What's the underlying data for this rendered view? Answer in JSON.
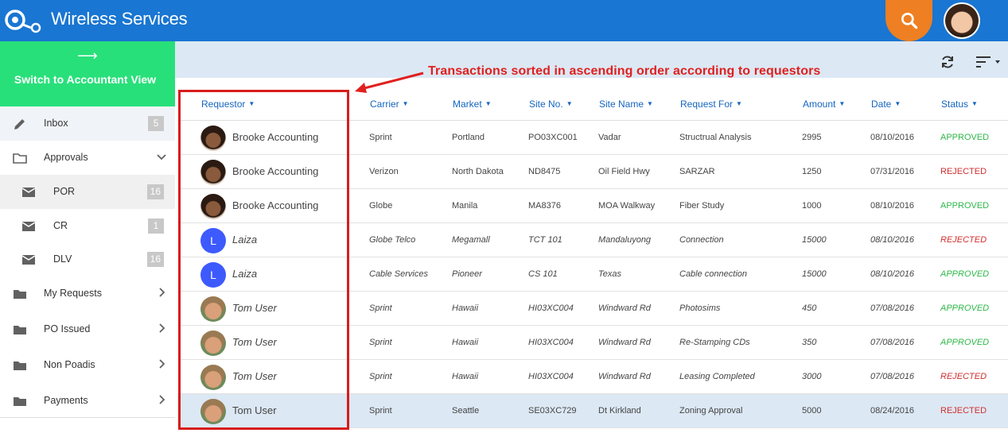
{
  "app": {
    "title": "Wireless Services"
  },
  "sidebar": {
    "switch_label": "Switch to Accountant View",
    "switch_arrow": "⟶",
    "items": [
      {
        "label": "Inbox",
        "badge": "5"
      },
      {
        "label": "Approvals"
      },
      {
        "label": "POR",
        "badge": "16"
      },
      {
        "label": "CR",
        "badge": "1"
      },
      {
        "label": "DLV",
        "badge": "16"
      },
      {
        "label": "My Requests"
      },
      {
        "label": "PO Issued"
      },
      {
        "label": "Non Poadis"
      },
      {
        "label": "Payments"
      }
    ]
  },
  "annotation": "Transactions sorted in ascending order according to requestors",
  "table": {
    "columns": [
      "Requestor",
      "Carrier",
      "Market",
      "Site No.",
      "Site Name",
      "Request For",
      "Amount",
      "Date",
      "Status"
    ],
    "rows": [
      {
        "requestor": "Brooke Accounting",
        "carrier": "Sprint",
        "market": "Portland",
        "site_no": "PO03XC001",
        "site_name": "Vadar",
        "request_for": "Structrual Analysis",
        "amount": "2995",
        "date": "08/10/2016",
        "status": "APPROVED"
      },
      {
        "requestor": "Brooke Accounting",
        "carrier": "Verizon",
        "market": "North Dakota",
        "site_no": "ND8475",
        "site_name": "Oil Field Hwy",
        "request_for": "SARZAR",
        "amount": "1250",
        "date": "07/31/2016",
        "status": "REJECTED"
      },
      {
        "requestor": "Brooke Accounting",
        "carrier": "Globe",
        "market": "Manila",
        "site_no": "MA8376",
        "site_name": "MOA Walkway",
        "request_for": "Fiber Study",
        "amount": "1000",
        "date": "08/10/2016",
        "status": "APPROVED"
      },
      {
        "requestor": "Laiza",
        "avatar_letter": "L",
        "carrier": "Globe Telco",
        "market": "Megamall",
        "site_no": "TCT 101",
        "site_name": "Mandaluyong",
        "request_for": "Connection",
        "amount": "15000",
        "date": "08/10/2016",
        "status": "REJECTED"
      },
      {
        "requestor": "Laiza",
        "avatar_letter": "L",
        "carrier": "Cable Services",
        "market": "Pioneer",
        "site_no": "CS 101",
        "site_name": "Texas",
        "request_for": "Cable connection",
        "amount": "15000",
        "date": "08/10/2016",
        "status": "APPROVED"
      },
      {
        "requestor": "Tom User",
        "carrier": "Sprint",
        "market": "Hawaii",
        "site_no": "HI03XC004",
        "site_name": "Windward Rd",
        "request_for": "Photosims",
        "amount": "450",
        "date": "07/08/2016",
        "status": "APPROVED"
      },
      {
        "requestor": "Tom User",
        "carrier": "Sprint",
        "market": "Hawaii",
        "site_no": "HI03XC004",
        "site_name": "Windward Rd",
        "request_for": "Re-Stamping CDs",
        "amount": "350",
        "date": "07/08/2016",
        "status": "APPROVED"
      },
      {
        "requestor": "Tom User",
        "carrier": "Sprint",
        "market": "Hawaii",
        "site_no": "HI03XC004",
        "site_name": "Windward Rd",
        "request_for": "Leasing Completed",
        "amount": "3000",
        "date": "07/08/2016",
        "status": "REJECTED"
      },
      {
        "requestor": "Tom User",
        "carrier": "Sprint",
        "market": "Seattle",
        "site_no": "SE03XC729",
        "site_name": "Dt Kirkland",
        "request_for": "Zoning Approval",
        "amount": "5000",
        "date": "08/24/2016",
        "status": "REJECTED"
      }
    ]
  },
  "colors": {
    "header": "#1976d2",
    "switch": "#28e07a",
    "search": "#ee7f22",
    "annotation": "#e0201f",
    "approved": "#2fb84a",
    "rejected": "#d32f2f"
  }
}
